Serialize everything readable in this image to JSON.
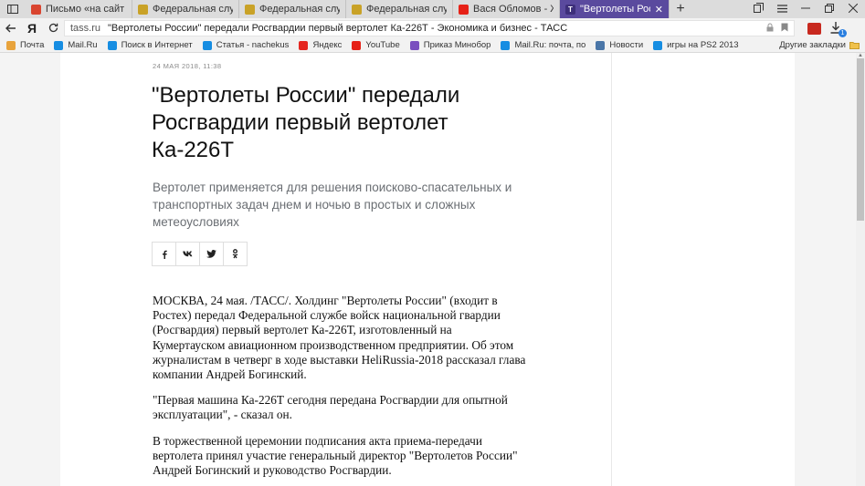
{
  "browser": {
    "tabs": [
      {
        "title": "Письмо «на сайт Мордов",
        "icon": "gmail-icon",
        "color": "#d9452f",
        "active": false
      },
      {
        "title": "Федеральная служба войс",
        "icon": "emblem-icon",
        "color": "#c9a227",
        "active": false
      },
      {
        "title": "Федеральная служба войс",
        "icon": "emblem-icon",
        "color": "#c9a227",
        "active": false
      },
      {
        "title": "Федеральная служба войс",
        "icon": "emblem-icon",
        "color": "#c9a227",
        "active": false
      },
      {
        "title": "Вася Обломов - Жизнь на",
        "icon": "youtube-icon",
        "color": "#e62117",
        "active": false
      },
      {
        "title": "\"Вертолеты России\" пер",
        "icon": "tass-icon",
        "color": "#3d2f7a",
        "active": true
      }
    ],
    "tass_letter": "T",
    "close_glyph": "✕",
    "new_tab_glyph": "+",
    "address": {
      "domain": "tass.ru",
      "page_title": "\"Вертолеты России\" передали Росгвардии первый вертолет Ка-226Т - Экономика и бизнес - ТАСС"
    },
    "ya_letter": "Я",
    "bookmarks": [
      {
        "label": "Почта",
        "icon": "mail-icon",
        "color": "#e8a33c"
      },
      {
        "label": "Mail.Ru",
        "icon": "mailru-icon",
        "color": "#168de2"
      },
      {
        "label": "Поиск в Интернет",
        "icon": "search-icon",
        "color": "#168de2"
      },
      {
        "label": "Статья - nachekus",
        "icon": "page-icon",
        "color": "#168de2"
      },
      {
        "label": "Яндекс",
        "icon": "yandex-icon",
        "color": "#e52620"
      },
      {
        "label": "YouTube",
        "icon": "youtube-icon",
        "color": "#e62117"
      },
      {
        "label": "Приказ Минобор",
        "icon": "emblem-icon",
        "color": "#7a4fbf"
      },
      {
        "label": "Mail.Ru: почта, по",
        "icon": "mailru-icon",
        "color": "#168de2"
      },
      {
        "label": "Новости",
        "icon": "vk-icon",
        "color": "#4a76a8"
      },
      {
        "label": "игры на PS2 2013",
        "icon": "search-icon",
        "color": "#168de2"
      }
    ],
    "other_bookmarks": "Другие закладки",
    "download_badge": "1"
  },
  "article": {
    "date": "24 мая 2018, 11:38",
    "headline": "\"Вертолеты России\" передали Росгвардии первый вертолет Ка-226Т",
    "lead": "Вертолет применяется для решения поисково-спасательных и транспортных задач днем и ночью в простых и сложных метеоусловиях",
    "share": [
      {
        "label": "f",
        "icon": "facebook-icon"
      },
      {
        "label": "vk",
        "icon": "vk-icon"
      },
      {
        "label": "tw",
        "icon": "twitter-icon"
      },
      {
        "label": "ok",
        "icon": "odnoklassniki-icon"
      }
    ],
    "paragraphs": [
      "МОСКВА, 24 мая. /ТАСС/. Холдинг \"Вертолеты России\" (входит в Ростех) передал Федеральной службе войск национальной гвардии (Росгвардия) первый вертолет Ка-226Т, изготовленный на Кумертауском авиационном производственном предприятии. Об этом журналистам в четверг в ходе выставки HeliRussia-2018 рассказал глава компании Андрей Богинский.",
      "\"Первая машина Ка-226Т сегодня передана Росгвардии для опытной эксплуатации\", - сказал он.",
      "В торжественной церемонии подписания акта приема-передачи вертолета принял участие генеральный директор \"Вертолетов России\" Андрей Богинский и руководство Росгвардии."
    ]
  }
}
